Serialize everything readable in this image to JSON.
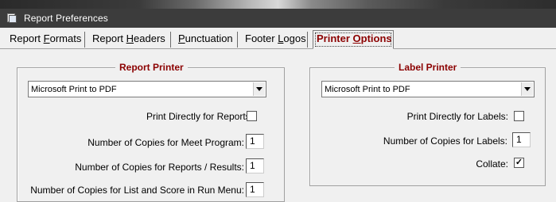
{
  "window": {
    "title": "Report Preferences"
  },
  "tabs": [
    {
      "pre": "Report ",
      "u": "F",
      "post": "ormats",
      "active": false
    },
    {
      "pre": "Report ",
      "u": "H",
      "post": "eaders",
      "active": false
    },
    {
      "pre": "",
      "u": "P",
      "post": "unctuation",
      "active": false
    },
    {
      "pre": "Footer ",
      "u": "L",
      "post": "ogos",
      "active": false
    },
    {
      "pre": "Printer ",
      "u": "O",
      "post": "ptions",
      "active": true
    }
  ],
  "report_printer": {
    "title": "Report Printer",
    "printer": "Microsoft Print to PDF",
    "print_directly_label": "Print Directly for Reports:",
    "print_directly_checked": false,
    "copies_meet_program_label": "Number of Copies for Meet Program:",
    "copies_meet_program": "1",
    "copies_reports_label": "Number of Copies for Reports / Results:",
    "copies_reports": "1",
    "copies_list_label": "Number of Copies for List and Score in Run Menu:",
    "copies_list": "1"
  },
  "label_printer": {
    "title": "Label Printer",
    "printer": "Microsoft Print to PDF",
    "print_directly_label": "Print Directly for Labels:",
    "print_directly_checked": false,
    "copies_labels_label": "Number of Copies for Labels:",
    "copies_labels": "1",
    "collate_label": "Collate:",
    "collate_checked": true,
    "check_mark": "✓"
  }
}
